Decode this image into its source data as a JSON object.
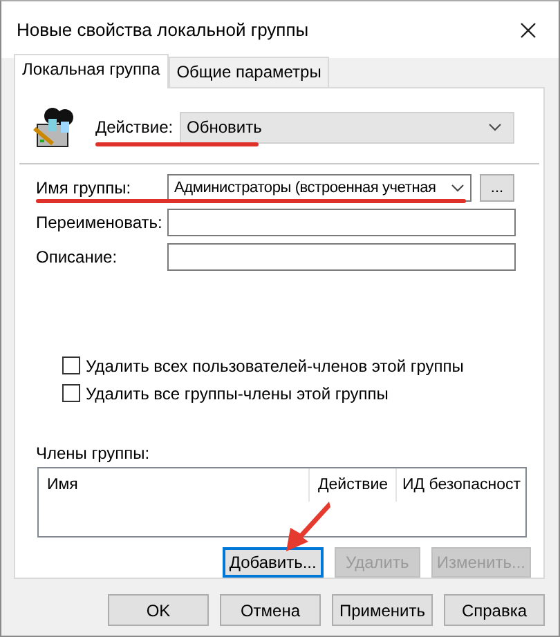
{
  "window": {
    "title": "Новые свойства локальной группы"
  },
  "tabs": [
    {
      "label": "Локальная группа",
      "selected": true
    },
    {
      "label": "Общие параметры",
      "selected": false
    }
  ],
  "action": {
    "label": "Действие:",
    "value": "Обновить"
  },
  "fields": [
    {
      "kind": "combo",
      "label": "Имя группы:",
      "value": "Администраторы (встроенная учетная",
      "button": "..."
    },
    {
      "kind": "text",
      "label": "Переименовать:"
    },
    {
      "kind": "text",
      "label": "Описание:"
    }
  ],
  "checkboxes": [
    {
      "label": "Удалить всех пользователей-членов этой группы",
      "checked": false
    },
    {
      "label": "Удалить все группы-члены этой группы",
      "checked": false
    }
  ],
  "members": {
    "label": "Члены группы:",
    "columns": [
      "Имя",
      "Действие",
      "ИД безопасност"
    ]
  },
  "member_buttons": [
    {
      "label": "Добавить...",
      "disabled": false,
      "focused": true
    },
    {
      "label": "Удалить",
      "disabled": true,
      "focused": false
    },
    {
      "label": "Изменить...",
      "disabled": true,
      "focused": false
    }
  ],
  "buttons": [
    "OK",
    "Отмена",
    "Применить",
    "Справка"
  ]
}
